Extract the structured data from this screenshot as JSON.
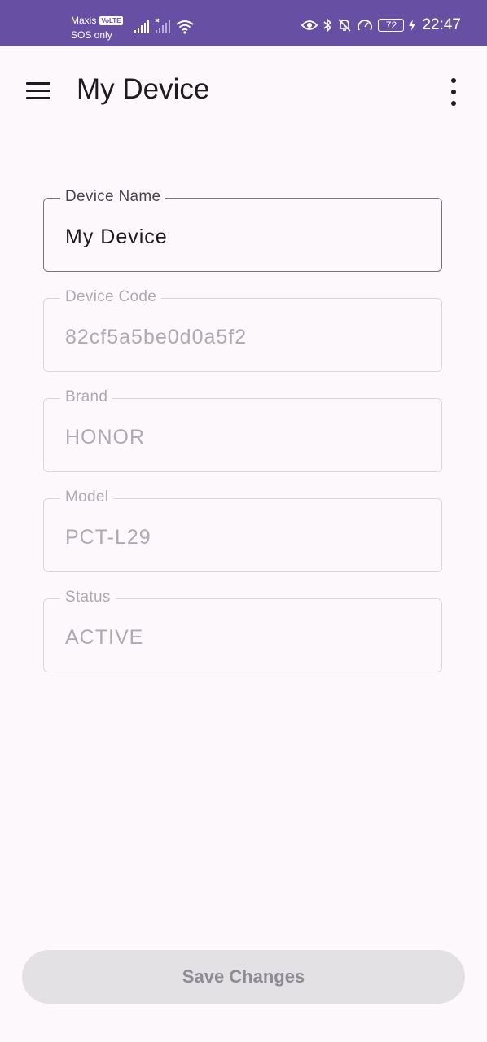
{
  "status_bar": {
    "carrier": "Maxis",
    "volte": "VoLTE",
    "sos": "SOS only",
    "battery": "72",
    "time": "22:47",
    "icons": [
      "signal-icon",
      "signal-off-icon",
      "wifi-icon",
      "eye-icon",
      "bluetooth-icon",
      "mute-icon",
      "speed-icon",
      "battery-icon",
      "charging-icon"
    ]
  },
  "appbar": {
    "title": "My Device"
  },
  "fields": [
    {
      "label": "Device Name",
      "value": "My Device",
      "editable": true
    },
    {
      "label": "Device Code",
      "value": "82cf5a5be0d0a5f2",
      "editable": false
    },
    {
      "label": "Brand",
      "value": "HONOR",
      "editable": false
    },
    {
      "label": "Model",
      "value": "PCT-L29",
      "editable": false
    },
    {
      "label": "Status",
      "value": "ACTIVE",
      "editable": false
    }
  ],
  "save_button": {
    "label": "Save Changes",
    "enabled": false
  },
  "colors": {
    "status_bar": "#6750a4",
    "background": "#fdf8fc",
    "text_primary": "#1d1b20",
    "text_disabled": "#aeaab1",
    "button_disabled_bg": "#e4e1e5"
  }
}
